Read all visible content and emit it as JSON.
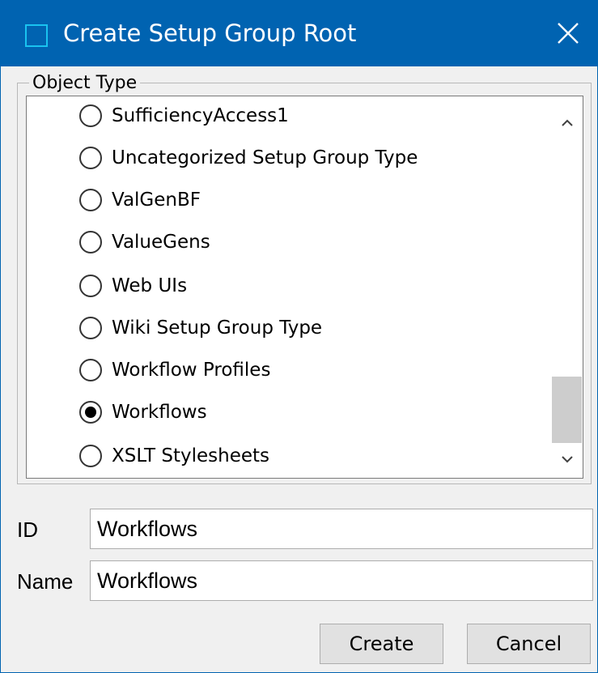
{
  "window": {
    "title": "Create Setup Group Root"
  },
  "object_type": {
    "legend": "Object Type",
    "options": [
      {
        "label": "SufficiencyAccess1",
        "selected": false
      },
      {
        "label": "Uncategorized Setup Group Type",
        "selected": false
      },
      {
        "label": "ValGenBF",
        "selected": false
      },
      {
        "label": "ValueGens",
        "selected": false
      },
      {
        "label": "Web UIs",
        "selected": false
      },
      {
        "label": "Wiki Setup Group Type",
        "selected": false
      },
      {
        "label": "Workflow Profiles",
        "selected": false
      },
      {
        "label": "Workflows",
        "selected": true
      },
      {
        "label": "XSLT Stylesheets",
        "selected": false
      }
    ],
    "selected_value": "Workflows"
  },
  "form": {
    "id_label": "ID",
    "id_value": "Workflows",
    "name_label": "Name",
    "name_value": "Workflows"
  },
  "buttons": {
    "create_label": "Create",
    "cancel_label": "Cancel"
  },
  "colors": {
    "titlebar": "#0063b1",
    "window_bg": "#f0f0f0",
    "button_bg": "#e1e1e1",
    "scroll_thumb": "#cdcdcd"
  }
}
